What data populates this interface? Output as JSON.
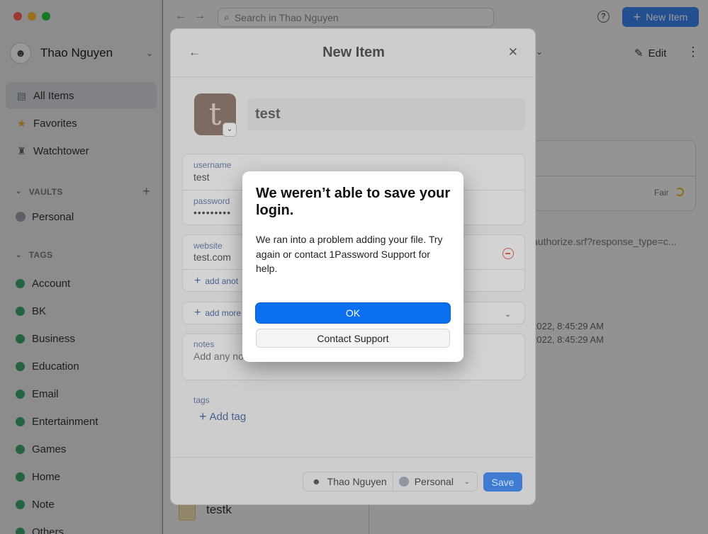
{
  "window": {
    "account_name": "Thao Nguyen",
    "search_placeholder": "Search in Thao Nguyen",
    "new_item_label": "New Item",
    "edit_label": "Edit"
  },
  "sidebar": {
    "items": [
      {
        "label": "All Items"
      },
      {
        "label": "Favorites"
      },
      {
        "label": "Watchtower"
      }
    ],
    "vaults_heading": "VAULTS",
    "vaults": [
      {
        "label": "Personal"
      }
    ],
    "tags_heading": "TAGS",
    "tags": [
      {
        "label": "Account"
      },
      {
        "label": "BK"
      },
      {
        "label": "Business"
      },
      {
        "label": "Education"
      },
      {
        "label": "Email"
      },
      {
        "label": "Entertainment"
      },
      {
        "label": "Games"
      },
      {
        "label": "Home"
      },
      {
        "label": "Note"
      },
      {
        "label": "Others"
      }
    ]
  },
  "detail": {
    "strength_label": "Fair",
    "url_text": "authorize.srf?response_type=c...",
    "date1": "2022, 8:45:29 AM",
    "date2": "2022, 8:45:29 AM",
    "list_item_title": "testk"
  },
  "new_item": {
    "title": "New Item",
    "item_title_value": "test",
    "username_label": "username",
    "username_value": "test",
    "password_label": "password",
    "password_value": "•••••••••",
    "website_label": "website",
    "website_value": "test.com",
    "add_another_label": "add anot",
    "add_more_label": "add more",
    "notes_label": "notes",
    "notes_placeholder": "Add any no",
    "tags_label": "tags",
    "add_tag_label": "Add tag",
    "owner_name": "Thao Nguyen",
    "vault_name": "Personal",
    "save_label": "Save"
  },
  "alert": {
    "title": "We weren’t able to save your login.",
    "message": "We ran into a problem adding your file. Try again or contact 1Password Support for help.",
    "ok_label": "OK",
    "support_label": "Contact Support"
  },
  "colors": {
    "accent": "#0b6ff0",
    "tag_dot": "#3fa56b",
    "danger": "#c6574d"
  }
}
